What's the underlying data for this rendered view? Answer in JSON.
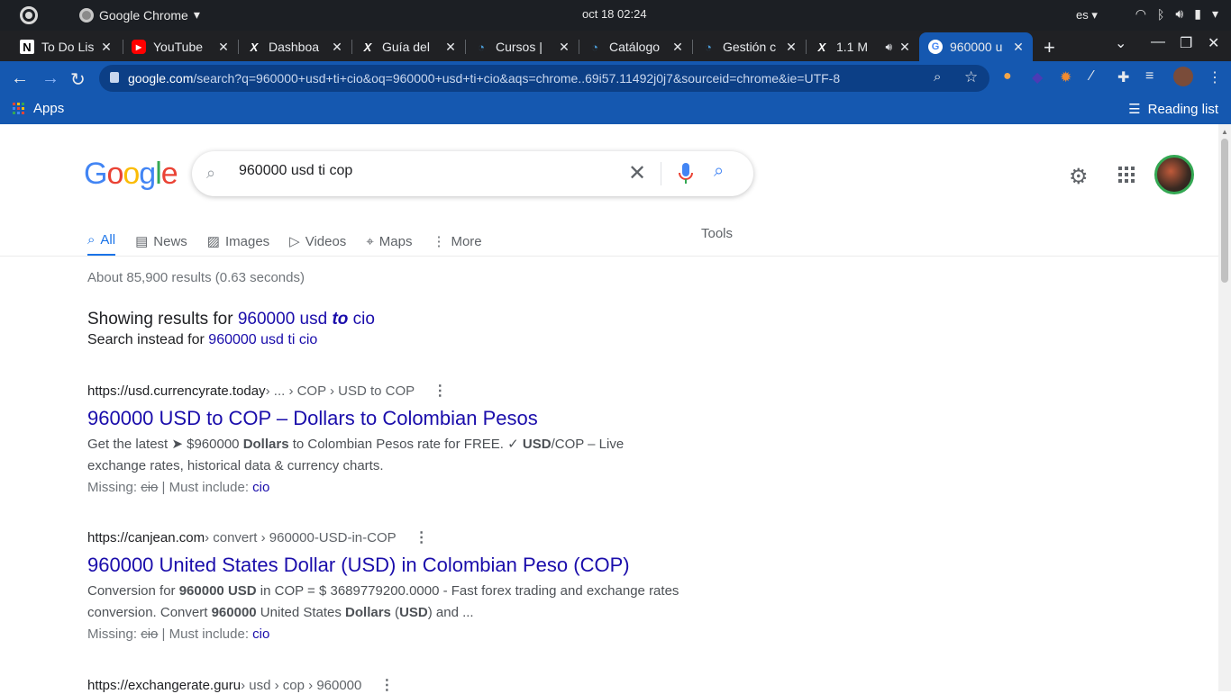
{
  "topbar": {
    "app_name": "Google Chrome",
    "clock": "oct 18  02:24",
    "lang": "es"
  },
  "tabs": [
    {
      "title": "To Do Lis",
      "icon": "notion-icon"
    },
    {
      "title": "YouTube",
      "icon": "youtube-icon"
    },
    {
      "title": "Dashboa",
      "icon": "x-brand-icon"
    },
    {
      "title": "Guía del ",
      "icon": "x-brand-icon"
    },
    {
      "title": "Cursos | ",
      "icon": "site-icon"
    },
    {
      "title": "Catálogo",
      "icon": "site-icon"
    },
    {
      "title": "Gestión c",
      "icon": "site-icon"
    },
    {
      "title": "1.1 M",
      "icon": "x-brand-icon"
    },
    {
      "title": "960000 u",
      "icon": "google-icon"
    }
  ],
  "omnibox": {
    "url_host": "google.com",
    "url_rest": "/search?q=960000+usd+ti+cio&oq=960000+usd+ti+cio&aqs=chrome..69i57.11492j0j7&sourceid=chrome&ie=UTF-8"
  },
  "bookmarks": {
    "apps": "Apps",
    "reading_list": "Reading list"
  },
  "search": {
    "query": "960000 usd ti cop"
  },
  "nav": {
    "all": "All",
    "news": "News",
    "images": "Images",
    "videos": "Videos",
    "maps": "Maps",
    "more": "More",
    "tools": "Tools"
  },
  "stats": "About 85,900 results (0.63 seconds)",
  "correction": {
    "showing_prefix": "Showing results for ",
    "showing_a": "960000 usd ",
    "showing_b": "to",
    "showing_c": " cio",
    "instead_prefix": "Search instead for ",
    "instead_link": "960000 usd ti cio"
  },
  "results": [
    {
      "host": "https://usd.currencyrate.today",
      "path": " › ... › COP › USD to COP",
      "title": "960000 USD to COP – Dollars to Colombian Pesos",
      "s1": "Get the latest ➤ $960000 ",
      "s1b": "Dollars",
      "s2": " to Colombian Pesos rate for FREE. ✓ ",
      "s2b": "USD",
      "s3": "/COP – Live exchange rates, historical data & currency charts.",
      "missing_label": "Missing: ",
      "missing_word": "cio",
      "must_label": " | Must include: ",
      "must_word": "cio"
    },
    {
      "host": "https://canjean.com",
      "path": " › convert › 960000-USD-in-COP",
      "title": "960000 United States Dollar (USD) in Colombian Peso (COP)",
      "s1": "Conversion for ",
      "s1b": "960000 USD",
      "s2": " in COP = $ 3689779200.0000 - Fast forex trading and exchange rates conversion. Convert ",
      "s2b": "960000",
      "s3": " United States ",
      "s3b": "Dollars",
      "s4": " (",
      "s4b": "USD",
      "s5": ") and ...",
      "missing_label": "Missing: ",
      "missing_word": "cio",
      "must_label": " | Must include: ",
      "must_word": "cio"
    },
    {
      "host": "https://exchangerate.guru",
      "path": " › usd › cop › 960000"
    }
  ]
}
